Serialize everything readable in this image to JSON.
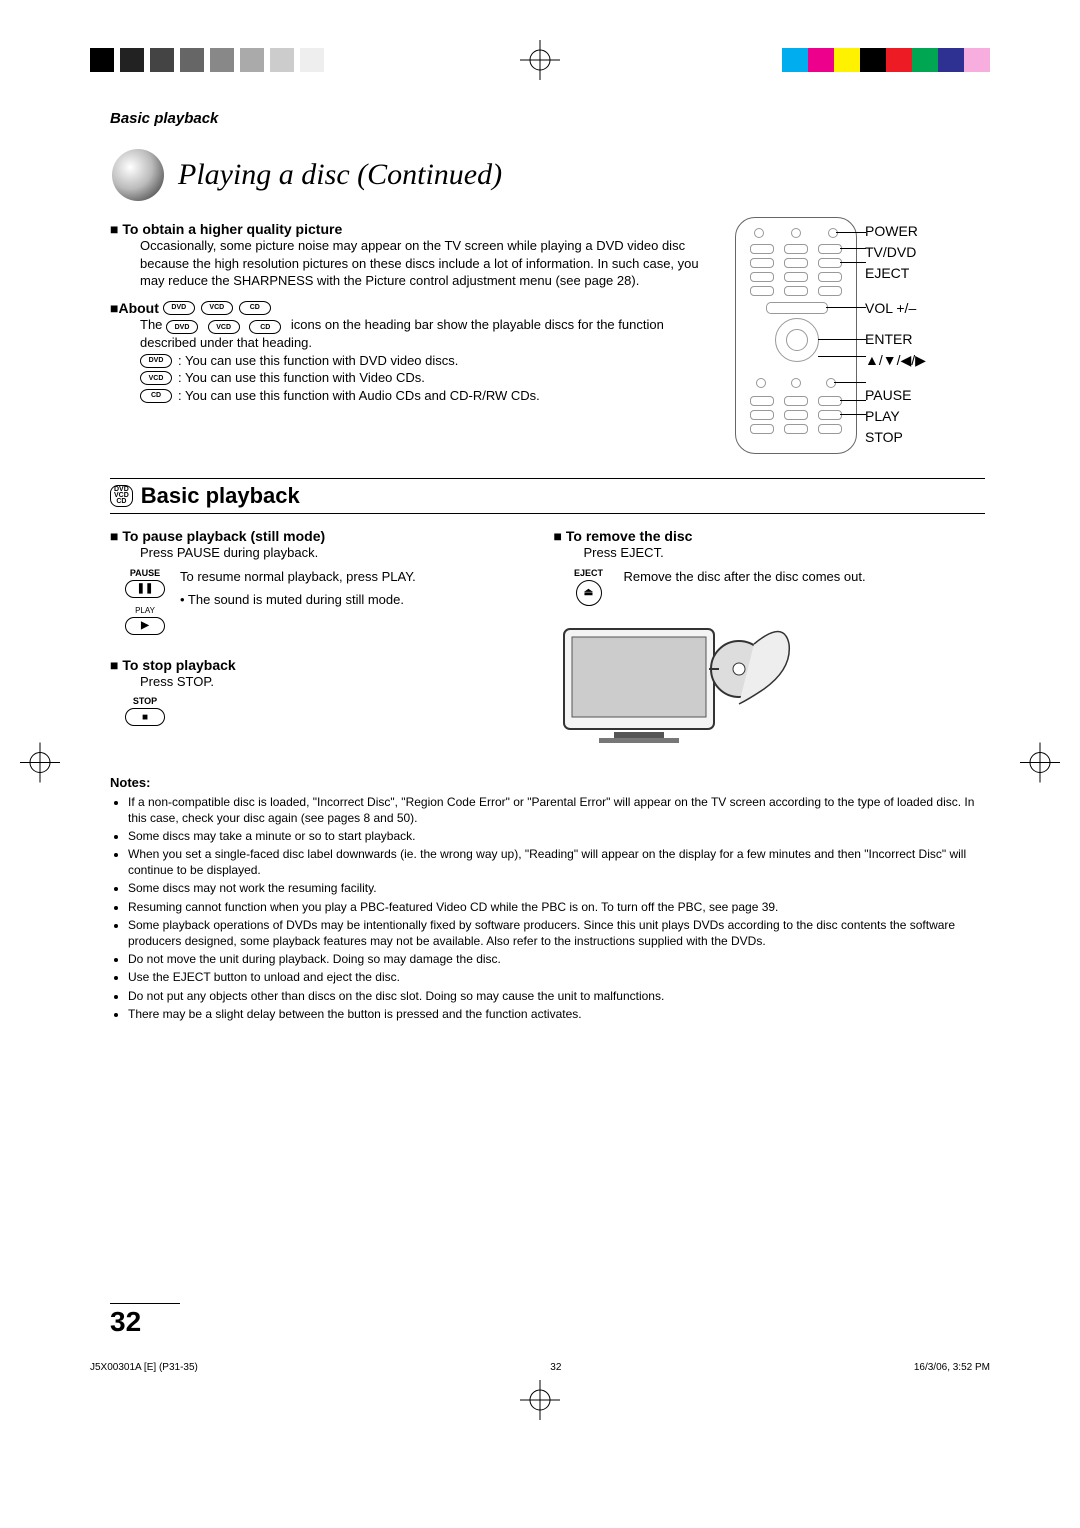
{
  "running_head": "Basic playback",
  "title": "Playing a disc (Continued)",
  "sec_quality": {
    "head": "To obtain a higher quality picture",
    "body": "Occasionally, some picture noise may appear on the TV screen while playing a DVD video disc because the high resolution pictures on these discs include a lot of information. In such case, you may reduce the SHARPNESS with the Picture control adjustment menu (see page 28)."
  },
  "sec_about": {
    "head": "About",
    "intro1": "The ",
    "intro2": " icons on the heading bar show the playable discs for the function described under that heading.",
    "dvd": ": You can use this function with DVD video discs.",
    "vcd": ": You can use this function with Video CDs.",
    "cd": ": You can use this function with Audio CDs and CD-R/RW CDs.",
    "icon_dvd": "DVD",
    "icon_vcd": "VCD",
    "icon_cd": "CD"
  },
  "remote_labels": {
    "power": "POWER",
    "tvdvd": "TV/DVD",
    "eject": "EJECT",
    "vol": "VOL +/–",
    "enter": "ENTER",
    "arrows": "▲/▼/◀/▶",
    "pause": "PAUSE",
    "play": "PLAY",
    "stop": "STOP"
  },
  "section_title": "Basic playback",
  "stack": {
    "l1": "DVD",
    "l2": "VCD",
    "l3": "CD"
  },
  "col1": {
    "pause_head": "To pause playback (still mode)",
    "pause_line": "Press PAUSE during playback.",
    "pause_lbl": "PAUSE",
    "play_lbl": "PLAY",
    "resume": "To resume normal playback, press PLAY.",
    "mute": "• The sound is muted during still mode.",
    "stop_head": "To stop playback",
    "stop_line": "Press STOP.",
    "stop_lbl": "STOP"
  },
  "col2": {
    "remove_head": "To remove the disc",
    "eject_line": "Press EJECT.",
    "eject_lbl": "EJECT",
    "remove_body": "Remove the disc after the disc comes out."
  },
  "notes_head": "Notes:",
  "notes": [
    "If a non-compatible disc is loaded, \"Incorrect Disc\", \"Region Code Error\" or \"Parental Error\" will appear on the TV screen according to the type of loaded disc. In this case, check your disc again (see pages 8 and 50).",
    "Some discs may take a minute or so to start playback.",
    "When you set a single-faced disc label downwards (ie. the wrong way up), \"Reading\" will appear on the display for a few minutes and then \"Incorrect Disc\" will continue to be displayed.",
    "Some discs may not work the resuming facility.",
    "Resuming cannot function when you play a PBC-featured Video CD while the PBC is on. To turn off the PBC, see page 39.",
    "Some playback operations of DVDs may be intentionally fixed by software producers. Since this unit plays DVDs according to the disc contents the software producers designed, some playback features may not be available. Also refer to the instructions supplied with the DVDs.",
    "Do not move the unit during playback. Doing so may damage the disc.",
    "Use the EJECT button to unload and eject the disc.",
    "Do not put any objects other than discs on the disc slot. Doing so may cause the unit to malfunctions.",
    "There may be a slight delay between the button is pressed and the function activates."
  ],
  "page_number": "32",
  "footer": {
    "left": "J5X00301A [E] (P31-35)",
    "center": "32",
    "right": "16/3/06, 3:52 PM"
  }
}
